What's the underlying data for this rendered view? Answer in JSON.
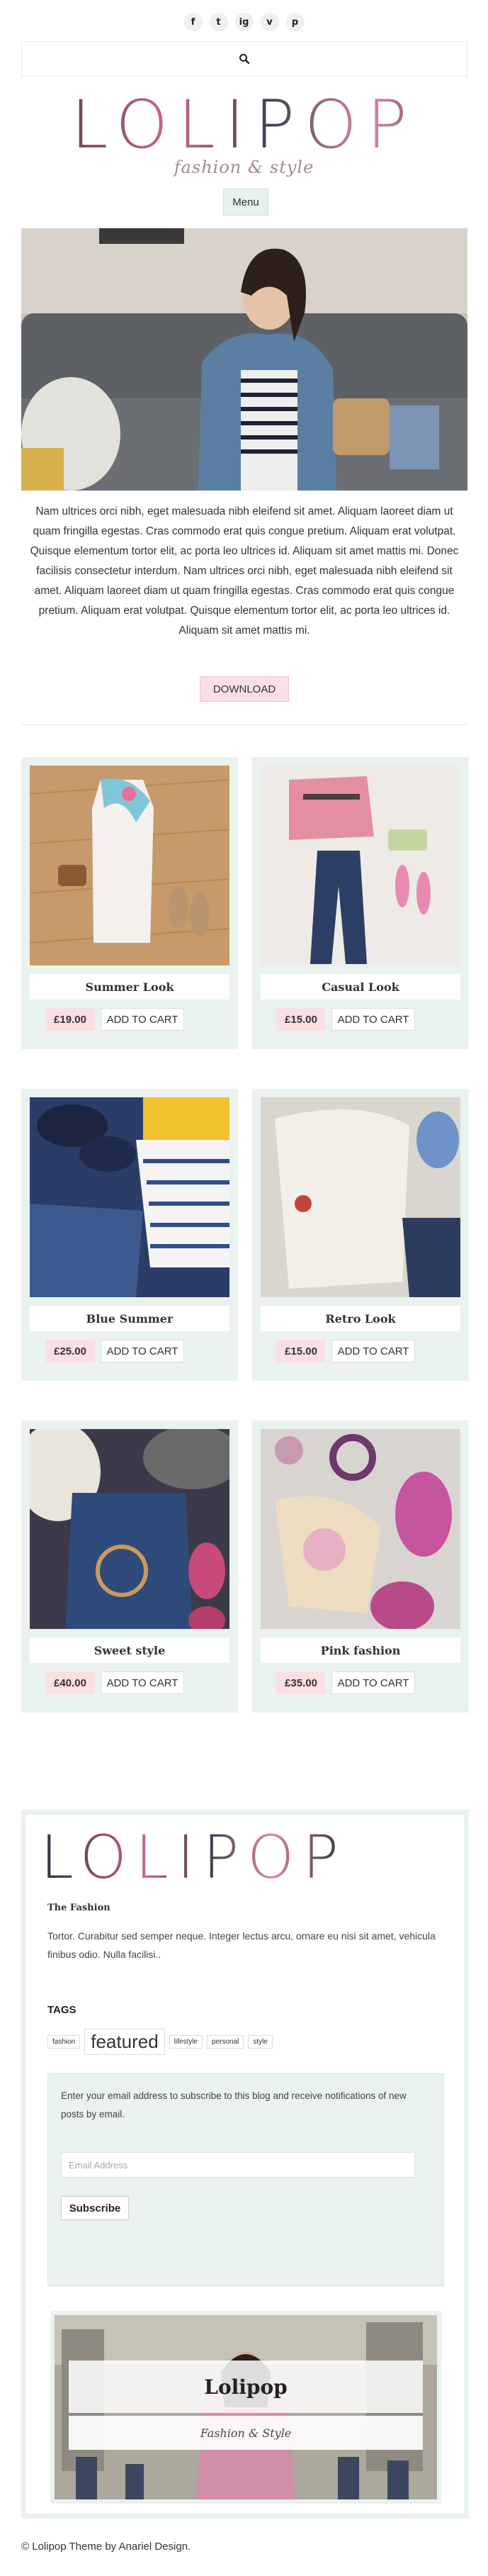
{
  "social": [
    "f",
    "t",
    "ig",
    "v",
    "p"
  ],
  "header": {
    "logo": "LOLIPOP",
    "tagline": "fashion & style",
    "menu_label": "Menu"
  },
  "intro": {
    "text": "Nam ultrices orci nibh, eget malesuada nibh eleifend sit amet. Aliquam laoreet diam ut quam fringilla egestas. Cras commodo erat quis congue pretium. Aliquam erat volutpat. Quisque elementum tortor elit, ac porta leo ultrices id. Aliquam sit amet mattis mi. Donec facilisis consectetur interdum. Nam ultrices orci nibh, eget malesuada nibh eleifend sit amet. Aliquam laoreet diam ut quam fringilla egestas. Cras commodo erat quis congue pretium. Aliquam erat volutpat. Quisque elementum tortor elit, ac porta leo ultrices id. Aliquam sit amet mattis mi.",
    "download_label": "DOWNLOAD"
  },
  "products": [
    {
      "title": "Summer Look",
      "price": "£19.00",
      "cart": "ADD TO CART"
    },
    {
      "title": "Casual Look",
      "price": "£15.00",
      "cart": "ADD TO CART"
    },
    {
      "title": "Blue Summer",
      "price": "£25.00",
      "cart": "ADD TO CART"
    },
    {
      "title": "Retro Look",
      "price": "£15.00",
      "cart": "ADD TO CART"
    },
    {
      "title": "Sweet style",
      "price": "£40.00",
      "cart": "ADD TO CART"
    },
    {
      "title": "Pink fashion",
      "price": "£35.00",
      "cart": "ADD TO CART"
    }
  ],
  "footer": {
    "logo": "LOLIPOP",
    "subtitle": "The Fashion",
    "description": "Tortor. Curabitur sed semper neque. Integer lectus arcu, ornare eu nisi sit amet, vehicula finibus odio. Nulla facilisi..",
    "tags_heading": "TAGS",
    "tags": [
      "fashion",
      "featured",
      "lifestyle",
      "personal",
      "style"
    ],
    "subscribe_text": "Enter your email address to subscribe to this blog and receive notifications of new posts by email.",
    "email_placeholder": "Email Address",
    "subscribe_label": "Subscribe",
    "promo_title": "Lolipop",
    "promo_subtitle": "Fashion & Style"
  },
  "credit": "© Lolipop Theme by Anariel Design."
}
